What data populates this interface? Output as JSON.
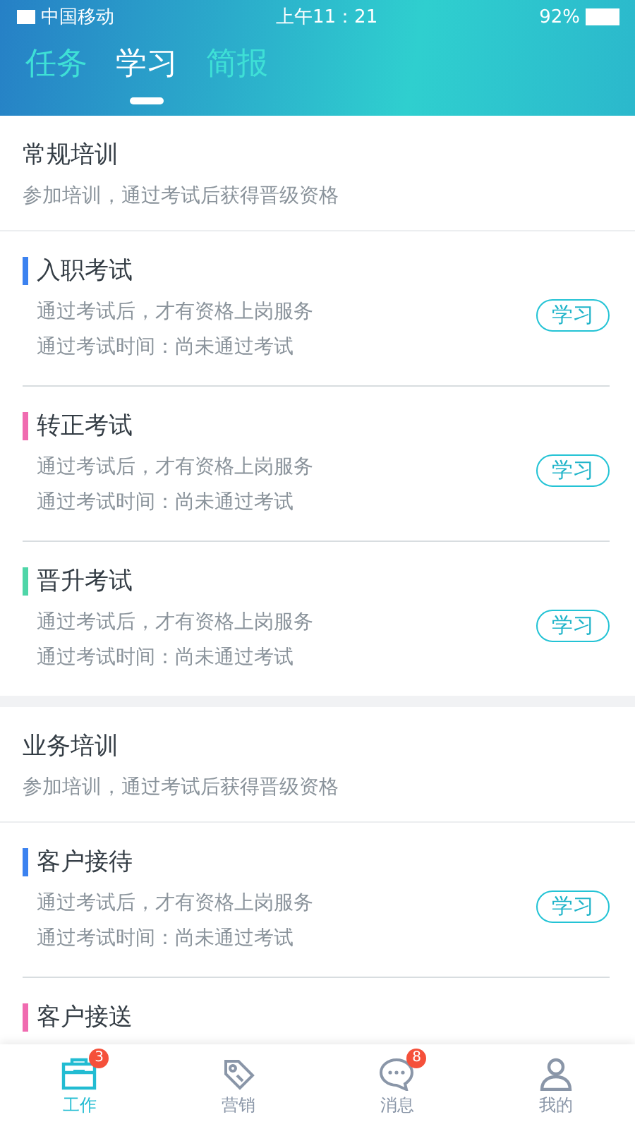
{
  "status_bar": {
    "carrier": "中国移动",
    "time": "上午11：21",
    "battery": "92%"
  },
  "tabs": [
    {
      "label": "任务",
      "selected": false
    },
    {
      "label": "学习",
      "selected": true
    },
    {
      "label": "简报",
      "selected": false
    }
  ],
  "sections": [
    {
      "title": "常规培训",
      "subtitle": "参加培训，通过考试后获得晋级资格",
      "exams": [
        {
          "title": "入职考试",
          "color": "#3b82f0",
          "desc": "通过考试后，才有资格上岗服务",
          "time": "通过考试时间：尚未通过考试",
          "button": "学习"
        },
        {
          "title": "转正考试",
          "color": "#f06bb0",
          "desc": "通过考试后，才有资格上岗服务",
          "time": "通过考试时间：尚未通过考试",
          "button": "学习"
        },
        {
          "title": "晋升考试",
          "color": "#4fd6a8",
          "desc": "通过考试后，才有资格上岗服务",
          "time": "通过考试时间：尚未通过考试",
          "button": "学习"
        }
      ]
    },
    {
      "title": "业务培训",
      "subtitle": "参加培训，通过考试后获得晋级资格",
      "exams": [
        {
          "title": "客户接待",
          "color": "#3b82f0",
          "desc": "通过考试后，才有资格上岗服务",
          "time": "通过考试时间：尚未通过考试",
          "button": "学习"
        },
        {
          "title": "客户接送",
          "color": "#f06bb0"
        }
      ]
    }
  ],
  "tab_bar": [
    {
      "kind": "work",
      "label": "工作",
      "selected": true,
      "badge": "3"
    },
    {
      "kind": "tag",
      "label": "营销",
      "selected": false
    },
    {
      "kind": "chat",
      "label": "消息",
      "selected": false,
      "badge": "8"
    },
    {
      "kind": "user",
      "label": "我的",
      "selected": false
    }
  ]
}
